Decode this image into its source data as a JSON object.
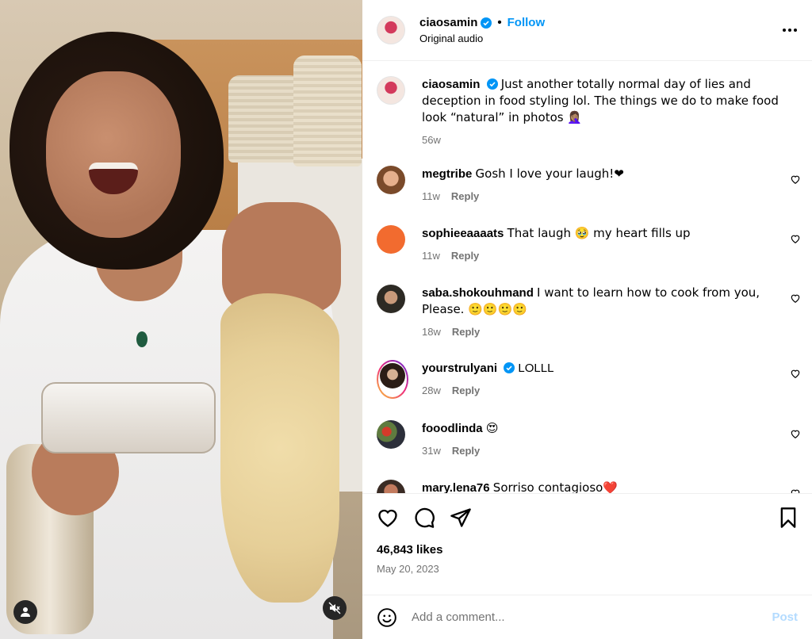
{
  "post": {
    "username": "ciaosamin",
    "audio": "Original audio",
    "follow_label": "Follow",
    "dot": "•"
  },
  "caption": {
    "username": "ciaosamin",
    "text": "Just another totally normal day of lies and deception in food styling lol. The things we do to make food look “natural” in photos 🤦🏽‍♀️",
    "age": "56w"
  },
  "comments": [
    {
      "username": "megtribe",
      "text": "Gosh I love your laugh!❤",
      "age": "11w",
      "reply": "Reply",
      "verified": false
    },
    {
      "username": "sophieeaaaats",
      "text": "That laugh 🥹 my heart fills up",
      "age": "11w",
      "reply": "Reply",
      "verified": false
    },
    {
      "username": "saba.shokouhmand",
      "text": "I want to learn how to cook from you, Please. 🙂🙂🙂🙂",
      "age": "18w",
      "reply": "Reply",
      "verified": false
    },
    {
      "username": "yourstrulyani",
      "text": "LOLLL",
      "age": "28w",
      "reply": "Reply",
      "verified": true
    },
    {
      "username": "fooodlinda",
      "text": "😍",
      "age": "31w",
      "reply": "Reply",
      "verified": false
    },
    {
      "username": "mary.lena76",
      "text": "Sorriso contagioso❤️",
      "age": "",
      "reply": "",
      "verified": false
    }
  ],
  "stats": {
    "likes": "46,843 likes",
    "date": "May 20, 2023"
  },
  "composer": {
    "placeholder": "Add a comment...",
    "post_label": "Post"
  },
  "colors": {
    "accent": "#0095f6",
    "verified": "#0095f6",
    "secondary_text": "#737373",
    "post_disabled": "#b3dbff"
  }
}
